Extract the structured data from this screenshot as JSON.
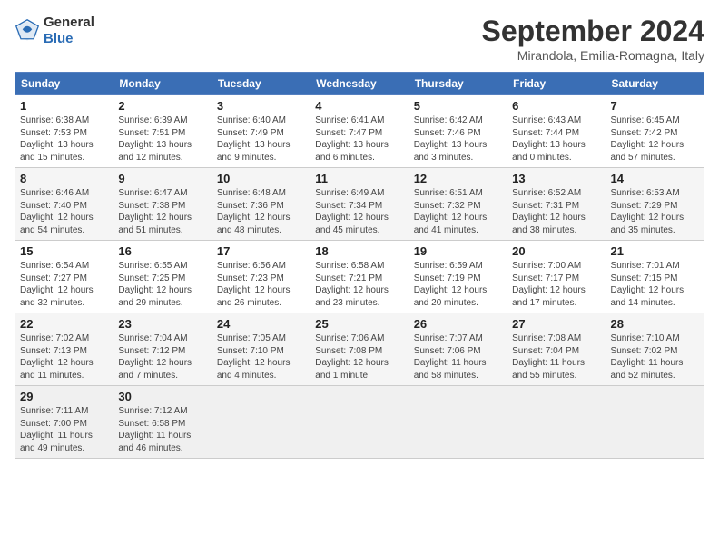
{
  "header": {
    "logo_line1": "General",
    "logo_line2": "Blue",
    "month_title": "September 2024",
    "location": "Mirandola, Emilia-Romagna, Italy"
  },
  "weekdays": [
    "Sunday",
    "Monday",
    "Tuesday",
    "Wednesday",
    "Thursday",
    "Friday",
    "Saturday"
  ],
  "weeks": [
    [
      {
        "day": "1",
        "detail": "Sunrise: 6:38 AM\nSunset: 7:53 PM\nDaylight: 13 hours\nand 15 minutes."
      },
      {
        "day": "2",
        "detail": "Sunrise: 6:39 AM\nSunset: 7:51 PM\nDaylight: 13 hours\nand 12 minutes."
      },
      {
        "day": "3",
        "detail": "Sunrise: 6:40 AM\nSunset: 7:49 PM\nDaylight: 13 hours\nand 9 minutes."
      },
      {
        "day": "4",
        "detail": "Sunrise: 6:41 AM\nSunset: 7:47 PM\nDaylight: 13 hours\nand 6 minutes."
      },
      {
        "day": "5",
        "detail": "Sunrise: 6:42 AM\nSunset: 7:46 PM\nDaylight: 13 hours\nand 3 minutes."
      },
      {
        "day": "6",
        "detail": "Sunrise: 6:43 AM\nSunset: 7:44 PM\nDaylight: 13 hours\nand 0 minutes."
      },
      {
        "day": "7",
        "detail": "Sunrise: 6:45 AM\nSunset: 7:42 PM\nDaylight: 12 hours\nand 57 minutes."
      }
    ],
    [
      {
        "day": "8",
        "detail": "Sunrise: 6:46 AM\nSunset: 7:40 PM\nDaylight: 12 hours\nand 54 minutes."
      },
      {
        "day": "9",
        "detail": "Sunrise: 6:47 AM\nSunset: 7:38 PM\nDaylight: 12 hours\nand 51 minutes."
      },
      {
        "day": "10",
        "detail": "Sunrise: 6:48 AM\nSunset: 7:36 PM\nDaylight: 12 hours\nand 48 minutes."
      },
      {
        "day": "11",
        "detail": "Sunrise: 6:49 AM\nSunset: 7:34 PM\nDaylight: 12 hours\nand 45 minutes."
      },
      {
        "day": "12",
        "detail": "Sunrise: 6:51 AM\nSunset: 7:32 PM\nDaylight: 12 hours\nand 41 minutes."
      },
      {
        "day": "13",
        "detail": "Sunrise: 6:52 AM\nSunset: 7:31 PM\nDaylight: 12 hours\nand 38 minutes."
      },
      {
        "day": "14",
        "detail": "Sunrise: 6:53 AM\nSunset: 7:29 PM\nDaylight: 12 hours\nand 35 minutes."
      }
    ],
    [
      {
        "day": "15",
        "detail": "Sunrise: 6:54 AM\nSunset: 7:27 PM\nDaylight: 12 hours\nand 32 minutes."
      },
      {
        "day": "16",
        "detail": "Sunrise: 6:55 AM\nSunset: 7:25 PM\nDaylight: 12 hours\nand 29 minutes."
      },
      {
        "day": "17",
        "detail": "Sunrise: 6:56 AM\nSunset: 7:23 PM\nDaylight: 12 hours\nand 26 minutes."
      },
      {
        "day": "18",
        "detail": "Sunrise: 6:58 AM\nSunset: 7:21 PM\nDaylight: 12 hours\nand 23 minutes."
      },
      {
        "day": "19",
        "detail": "Sunrise: 6:59 AM\nSunset: 7:19 PM\nDaylight: 12 hours\nand 20 minutes."
      },
      {
        "day": "20",
        "detail": "Sunrise: 7:00 AM\nSunset: 7:17 PM\nDaylight: 12 hours\nand 17 minutes."
      },
      {
        "day": "21",
        "detail": "Sunrise: 7:01 AM\nSunset: 7:15 PM\nDaylight: 12 hours\nand 14 minutes."
      }
    ],
    [
      {
        "day": "22",
        "detail": "Sunrise: 7:02 AM\nSunset: 7:13 PM\nDaylight: 12 hours\nand 11 minutes."
      },
      {
        "day": "23",
        "detail": "Sunrise: 7:04 AM\nSunset: 7:12 PM\nDaylight: 12 hours\nand 7 minutes."
      },
      {
        "day": "24",
        "detail": "Sunrise: 7:05 AM\nSunset: 7:10 PM\nDaylight: 12 hours\nand 4 minutes."
      },
      {
        "day": "25",
        "detail": "Sunrise: 7:06 AM\nSunset: 7:08 PM\nDaylight: 12 hours\nand 1 minute."
      },
      {
        "day": "26",
        "detail": "Sunrise: 7:07 AM\nSunset: 7:06 PM\nDaylight: 11 hours\nand 58 minutes."
      },
      {
        "day": "27",
        "detail": "Sunrise: 7:08 AM\nSunset: 7:04 PM\nDaylight: 11 hours\nand 55 minutes."
      },
      {
        "day": "28",
        "detail": "Sunrise: 7:10 AM\nSunset: 7:02 PM\nDaylight: 11 hours\nand 52 minutes."
      }
    ],
    [
      {
        "day": "29",
        "detail": "Sunrise: 7:11 AM\nSunset: 7:00 PM\nDaylight: 11 hours\nand 49 minutes."
      },
      {
        "day": "30",
        "detail": "Sunrise: 7:12 AM\nSunset: 6:58 PM\nDaylight: 11 hours\nand 46 minutes."
      },
      {
        "day": "",
        "detail": ""
      },
      {
        "day": "",
        "detail": ""
      },
      {
        "day": "",
        "detail": ""
      },
      {
        "day": "",
        "detail": ""
      },
      {
        "day": "",
        "detail": ""
      }
    ]
  ]
}
